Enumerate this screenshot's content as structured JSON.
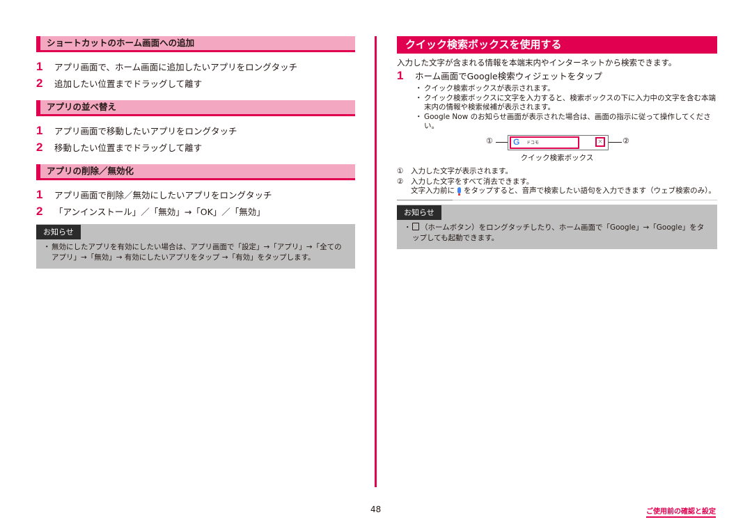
{
  "left": {
    "sections": [
      {
        "title": "ショートカットのホーム画面への追加",
        "steps": [
          {
            "num": "1",
            "text": "アプリ画面で、ホーム画面に追加したいアプリをロングタッチ"
          },
          {
            "num": "2",
            "text": "追加したい位置までドラッグして離す"
          }
        ]
      },
      {
        "title": "アプリの並べ替え",
        "steps": [
          {
            "num": "1",
            "text": "アプリ画面で移動したいアプリをロングタッチ"
          },
          {
            "num": "2",
            "text": "移動したい位置までドラッグして離す"
          }
        ]
      },
      {
        "title": "アプリの削除／無効化",
        "steps": [
          {
            "num": "1",
            "text": "アプリ画面で削除／無効にしたいアプリをロングタッチ"
          },
          {
            "num": "2",
            "text": "「アンインストール」／「無効」→「OK」／「無効」"
          }
        ]
      }
    ],
    "note": {
      "tag": "お知らせ",
      "lines": [
        "無効にしたアプリを有効にしたい場合は、アプリ画面で「設定」→「アプリ」→「全てのアプリ」→「無効」→ 有効にしたいアプリをタップ →「有効」をタップします。"
      ]
    }
  },
  "right": {
    "title": "クイック検索ボックスを使用する",
    "intro": "入力した文字が含まれる情報を本端末内やインターネットから検索できます。",
    "step": {
      "num": "1",
      "text": "ホーム画面でGoogle検索ウィジェットをタップ"
    },
    "bullets": [
      "クイック検索ボックスが表示されます。",
      "クイック検索ボックスに文字を入力すると、検索ボックスの下に入力中の文字を含む本端末内の情報や検索候補が表示されます。",
      "Google Now のお知らせ画面が表示された場合は、画面の指示に従って操作してください。"
    ],
    "figure": {
      "callout_1": "①",
      "callout_2": "②",
      "g_icon": "G",
      "field_text": "ドコモ",
      "clear_icon": "×",
      "caption": "クイック検索ボックス"
    },
    "descriptions": [
      {
        "num": "①",
        "text": "入力した文字が表示されます。"
      },
      {
        "num": "②",
        "text": "入力した文字をすべて消去できます。"
      }
    ],
    "voice_pre": "文字入力前に",
    "voice_post": "をタップすると、音声で検索したい語句を入力できます（ウェブ検索のみ）。",
    "note": {
      "tag": "お知らせ",
      "line_after_icon": "（ホームボタン）をロングタッチしたり、ホーム画面で「Google」→「Google」をタップしても起動できます。"
    }
  },
  "footer": {
    "page_number": "48",
    "chapter": "ご使用前の確認と設定"
  },
  "colors": {
    "accent": "#e0004f",
    "section_bg": "#f4a7c1",
    "note_bg": "#c0c0c0",
    "note_tag_bg": "#2b2b2b"
  }
}
